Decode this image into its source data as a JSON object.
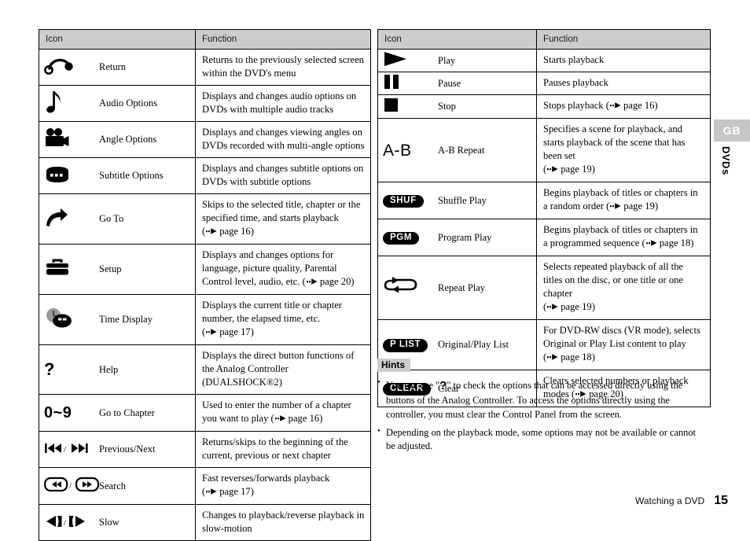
{
  "left_table": {
    "headers": {
      "icon": "Icon",
      "function": "Function"
    },
    "rows": [
      {
        "icon_kind": "return",
        "label": "Return",
        "function": "Returns to the previously selected screen within the DVD's menu"
      },
      {
        "icon_kind": "note",
        "label": "Audio Options",
        "function": "Displays and changes audio options on DVDs with multiple audio tracks"
      },
      {
        "icon_kind": "camera",
        "label": "Angle Options",
        "function": "Displays and changes viewing angles on DVDs recorded with multi-angle options"
      },
      {
        "icon_kind": "subtitle",
        "label": "Subtitle Options",
        "function": "Displays and changes subtitle options on DVDs with subtitle options"
      },
      {
        "icon_kind": "goto",
        "label": "Go To",
        "function": "Skips to the selected title, chapter or the specified time, and starts playback",
        "ref_page": "page 16"
      },
      {
        "icon_kind": "toolbox",
        "label": "Setup",
        "function": "Displays and changes options for language, picture quality, Parental Control level, audio, etc.",
        "ref_page": "page 20",
        "ref_inline": true
      },
      {
        "icon_kind": "clockdisc",
        "label": "Time Display",
        "function": "Displays the current title or chapter number, the elapsed time, etc.",
        "ref_page": "page 17"
      },
      {
        "icon_kind": "help",
        "label": "Help",
        "function": "Displays the direct button functions of the Analog Controller (DUALSHOCK®2)"
      },
      {
        "icon_kind": "numbers",
        "label": "Go to Chapter",
        "icon_text": "0~9",
        "function": "Used to enter the number of a chapter you want to play",
        "ref_page": "page 16",
        "ref_inline": true
      },
      {
        "icon_kind": "prevnext",
        "label": "Previous/Next",
        "function": "Returns/skips to the beginning of the current, previous or next chapter"
      },
      {
        "icon_kind": "search",
        "label": "Search",
        "function": "Fast reverses/forwards playback",
        "ref_page": "page 17"
      },
      {
        "icon_kind": "slow",
        "label": "Slow",
        "function": "Changes to playback/reverse playback in slow-motion"
      }
    ]
  },
  "right_table": {
    "headers": {
      "icon": "Icon",
      "function": "Function"
    },
    "rows": [
      {
        "icon_kind": "play",
        "label": "Play",
        "function": "Starts playback"
      },
      {
        "icon_kind": "pause",
        "label": "Pause",
        "function": "Pauses playback"
      },
      {
        "icon_kind": "stop",
        "label": "Stop",
        "function": "Stops playback",
        "ref_page": "page 16",
        "ref_inline": true
      },
      {
        "icon_kind": "abtext",
        "label": "A-B Repeat",
        "icon_text": "A-B",
        "function": "Specifies a scene for playback, and starts playback of the scene that has been set",
        "ref_page": "page 19"
      },
      {
        "icon_kind": "pill",
        "label": "Shuffle Play",
        "icon_text": "SHUF",
        "function": "Begins playback of titles or chapters in a random order",
        "ref_page": "page 19",
        "ref_inline": true
      },
      {
        "icon_kind": "pill",
        "label": "Program Play",
        "icon_text": "PGM",
        "function": "Begins playback of titles or chapters in a programmed sequence",
        "ref_page": "page 18",
        "ref_inline": true
      },
      {
        "icon_kind": "repeat",
        "label": "Repeat Play",
        "function": "Selects repeated playback of all the titles on the disc, or one title or one chapter",
        "ref_page": "page 19"
      },
      {
        "icon_kind": "pill",
        "label": "Original/Play List",
        "icon_text": "P LIST",
        "function": "For DVD-RW discs (VR mode), selects Original or Play List content to play",
        "ref_page": "page 18"
      },
      {
        "icon_kind": "pill",
        "label": "Clear",
        "icon_text": "CLEAR",
        "function": "Clears selected numbers or playback modes",
        "ref_page": "page 20",
        "ref_inline": true
      }
    ]
  },
  "hints": {
    "title": "Hints",
    "items": [
      {
        "pre": "You can use \"",
        "symbol": "?",
        "post": "\" to check the options that can be accessed directly using the buttons of the Analog Controller. To access the options directly using the controller, you must clear the Control Panel from the screen."
      },
      {
        "pre": "",
        "symbol": "",
        "post": "Depending on the playback mode, some options may not be available or cannot be adjusted."
      }
    ]
  },
  "side_tab": {
    "region": "GB",
    "section": "DVDs"
  },
  "footer": {
    "text": "Watching a DVD",
    "page": "15"
  },
  "colors": {
    "header_bg": "#cccccc",
    "tab_bg": "#c6c6c6",
    "ink": "#000000",
    "page_bg": "#ffffff"
  }
}
